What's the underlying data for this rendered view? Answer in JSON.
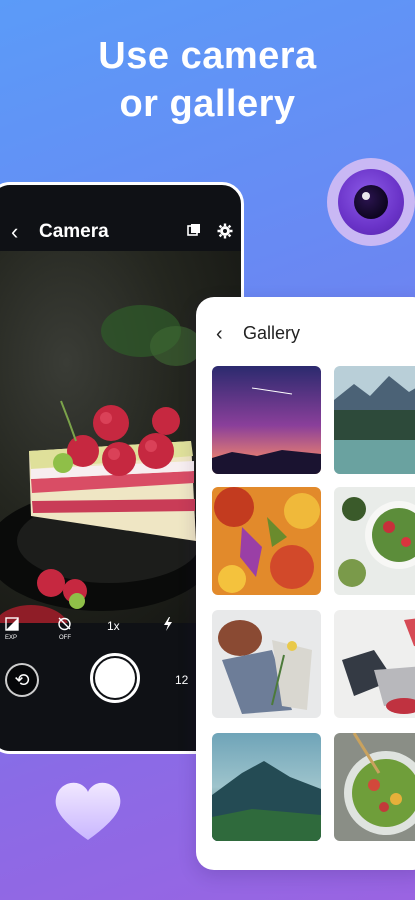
{
  "headline": {
    "line1": "Use camera",
    "line2": "or gallery"
  },
  "camera": {
    "back_icon": "chevron-left-icon",
    "title": "Camera",
    "top_icons": [
      "aspect-ratio-icon",
      "gear-icon"
    ],
    "controls": {
      "exposure_label": "EXP",
      "timer_label": "OFF",
      "zoom_label": "1x",
      "flash_icon": "flash-icon",
      "counter_label": "12"
    },
    "shutter_icon": "shutter-button-icon",
    "flip_icon": "flip-camera-icon"
  },
  "gallery": {
    "back_icon": "chevron-left-icon",
    "title": "Gallery",
    "thumbnails": [
      "starry-sky-photo",
      "mountain-lake-photo",
      "autumn-leaves-photo",
      "salad-table-photo",
      "clothes-flatlay-photo",
      "shoes-flatlay-photo",
      "foggy-mountain-photo",
      "salad-bowl-photo"
    ]
  },
  "decor": {
    "lens_icon": "camera-lens-icon",
    "heart_icon": "heart-icon"
  }
}
